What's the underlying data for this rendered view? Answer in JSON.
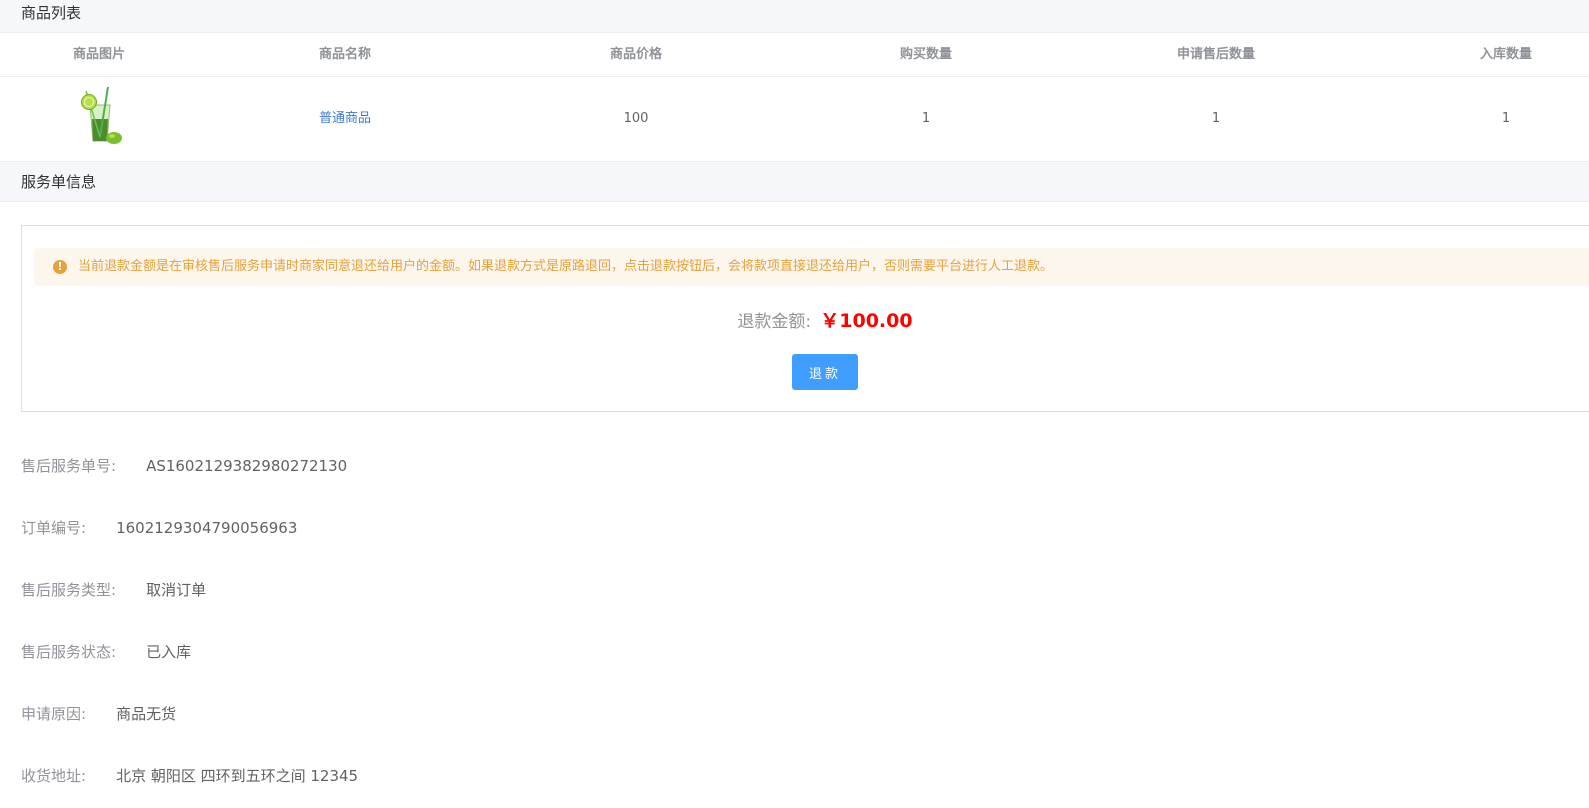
{
  "goods_section": {
    "title": "商品列表",
    "columns": [
      "商品图片",
      "商品名称",
      "商品价格",
      "购买数量",
      "申请售后数量",
      "入库数量"
    ],
    "rows": [
      {
        "image": "mojito-drink-thumbnail",
        "name": "普通商品",
        "price": "100",
        "buy_qty": "1",
        "apply_qty": "1",
        "stock_qty": "1"
      }
    ]
  },
  "service_section": {
    "title": "服务单信息",
    "alert": "当前退款金额是在审核售后服务申请时商家同意退还给用户的金额。如果退款方式是原路退回，点击退款按钮后，会将款项直接退还给用户，否则需要平台进行人工退款。",
    "alert_icon": "warning-icon",
    "refund_label": "退款金额:",
    "refund_amount": "￥100.00",
    "refund_button": "退款"
  },
  "details": [
    {
      "label": "售后服务单号:",
      "value": "AS1602129382980272130"
    },
    {
      "label": "订单编号:",
      "value": "1602129304790056963"
    },
    {
      "label": "售后服务类型:",
      "value": "取消订单"
    },
    {
      "label": "售后服务状态:",
      "value": "已入库"
    },
    {
      "label": "申请原因:",
      "value": "商品无货"
    },
    {
      "label": "收货地址:",
      "value": "北京 朝阳区 四环到五环之间 12345"
    }
  ],
  "colors": {
    "primary": "#409eff",
    "warning": "#e6a23c",
    "warning_bg": "#fdf6ec",
    "amount": "#ff0000",
    "link": "#3e7ad1"
  }
}
